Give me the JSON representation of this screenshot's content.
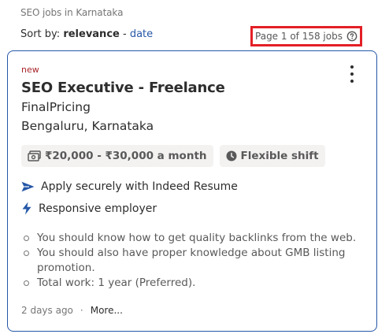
{
  "search_context": "SEO jobs in Karnataka",
  "sort": {
    "label": "Sort by:",
    "active": "relevance",
    "separator": "-",
    "alternate": "date"
  },
  "page_count": "Page 1 of 158 jobs",
  "job": {
    "badge": "new",
    "title": "SEO Executive - Freelance",
    "company": "FinalPricing",
    "location": "Bengaluru, Karnataka",
    "salary": "₹20,000 - ₹30,000 a month",
    "shift": "Flexible shift",
    "features": [
      "Apply securely with Indeed Resume",
      "Responsive employer"
    ],
    "snippet": [
      "You should know how to get quality backlinks from the web.",
      "You should also have proper knowledge about GMB listing promotion.",
      "Total work: 1 year (Preferred)."
    ],
    "posted": "2 days ago",
    "footer_separator": "·",
    "more": "More..."
  },
  "colors": {
    "link": "#2557a7",
    "highlight_box": "#e41f26",
    "new_badge": "#a9252b"
  },
  "icons": [
    "help-icon",
    "kebab-menu-icon",
    "money-icon",
    "clock-icon",
    "send-arrow-icon",
    "lightning-icon"
  ]
}
